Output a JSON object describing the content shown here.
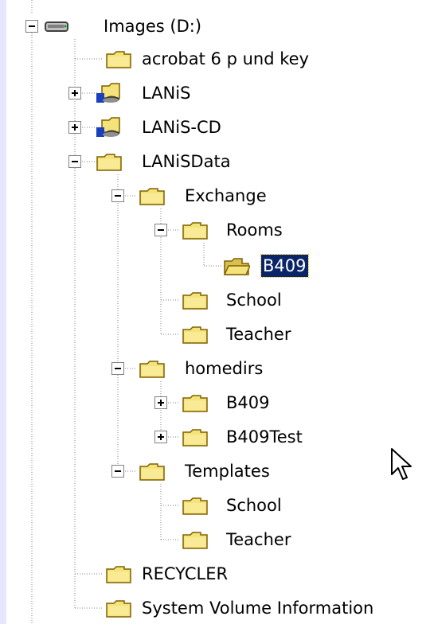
{
  "colors": {
    "background": "#e6e6ff",
    "tree_background": "#ffffff",
    "folder_fill": "#f4e27a",
    "folder_outline": "#806000",
    "selection": "#0a246a",
    "tree_line": "#808080"
  },
  "tree": {
    "root": {
      "label": "Images (D:)",
      "icon": "drive-icon",
      "state": "expanded"
    },
    "items": [
      {
        "label": "acrobat 6 p und key",
        "icon": "folder-icon",
        "state": "leaf"
      },
      {
        "label": "LANiS",
        "icon": "network-folder-icon",
        "state": "collapsed"
      },
      {
        "label": "LANiS-CD",
        "icon": "network-folder-icon",
        "state": "collapsed"
      },
      {
        "label": "LANiSData",
        "icon": "folder-icon",
        "state": "expanded"
      },
      {
        "label": "Exchange",
        "icon": "folder-icon",
        "state": "expanded"
      },
      {
        "label": "Rooms",
        "icon": "folder-icon",
        "state": "expanded"
      },
      {
        "label": "B409",
        "icon": "open-folder-icon",
        "state": "selected"
      },
      {
        "label": "School",
        "icon": "folder-icon",
        "state": "leaf"
      },
      {
        "label": "Teacher",
        "icon": "folder-icon",
        "state": "leaf"
      },
      {
        "label": "homedirs",
        "icon": "folder-icon",
        "state": "expanded"
      },
      {
        "label": "B409",
        "icon": "folder-icon",
        "state": "collapsed"
      },
      {
        "label": "B409Test",
        "icon": "folder-icon",
        "state": "collapsed"
      },
      {
        "label": "Templates",
        "icon": "folder-icon",
        "state": "expanded"
      },
      {
        "label": "School",
        "icon": "folder-icon",
        "state": "leaf"
      },
      {
        "label": "Teacher",
        "icon": "folder-icon",
        "state": "leaf"
      },
      {
        "label": "RECYCLER",
        "icon": "folder-icon",
        "state": "leaf"
      },
      {
        "label": "System Volume Information",
        "icon": "folder-icon",
        "state": "leaf"
      }
    ]
  },
  "cursor": {
    "icon": "mouse-pointer-icon"
  }
}
